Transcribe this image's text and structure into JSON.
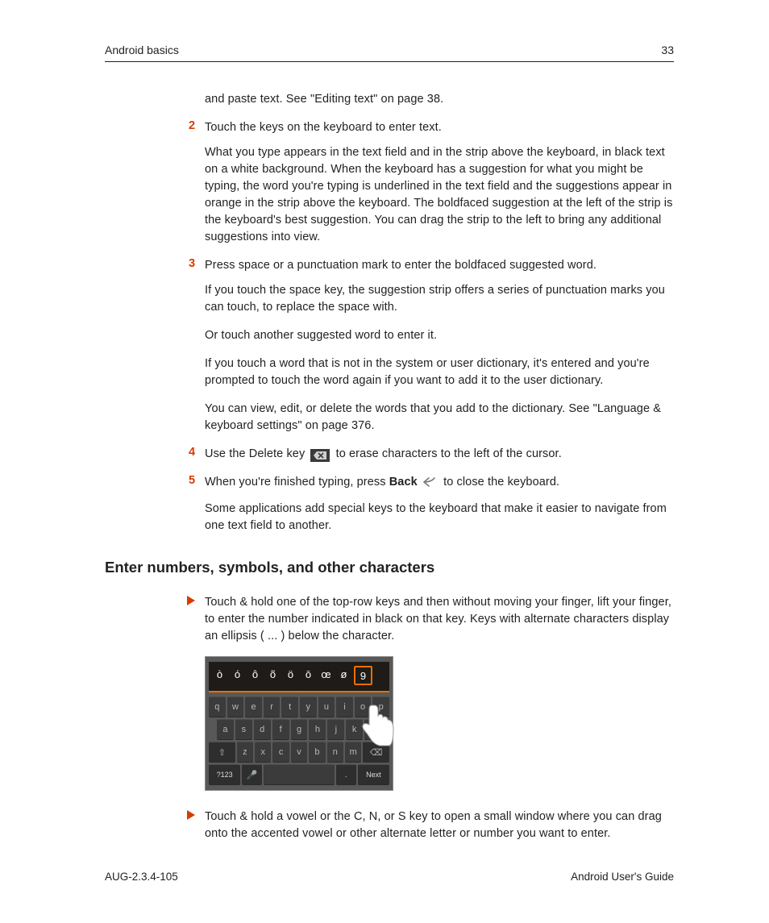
{
  "header": {
    "section": "Android basics",
    "page_number": "33"
  },
  "footer": {
    "doc_id": "AUG-2.3.4-105",
    "title": "Android User's Guide"
  },
  "intro_tail": "and paste text. See \"Editing text\" on page 38.",
  "steps": [
    {
      "num": "2",
      "lead": "Touch the keys on the keyboard to enter text.",
      "paras": [
        "What you type appears in the text field and in the strip above the keyboard, in black text on a white background. When the keyboard has a suggestion for what you might be typing, the word you're typing is underlined in the text field and the suggestions appear in orange in the strip above the keyboard. The boldfaced suggestion at the left of the strip is the keyboard's best suggestion. You can drag the strip to the left to bring any additional suggestions into view."
      ]
    },
    {
      "num": "3",
      "lead": "Press space or a punctuation mark to enter the boldfaced suggested word.",
      "paras": [
        "If you touch the space key, the suggestion strip offers a series of punctuation marks you can touch, to replace the space with.",
        "Or touch another suggested word to enter it.",
        "If you touch a word that is not in the system or user dictionary, it's entered and you're prompted to touch the word again if you want to add it to the user dictionary.",
        "You can view, edit, or delete the words that you add to the dictionary. See \"Language & keyboard settings\" on page 376."
      ]
    },
    {
      "num": "4",
      "lead_pre": "Use the Delete key ",
      "lead_post": " to erase characters to the left of the cursor."
    },
    {
      "num": "5",
      "lead_pre": "When you're finished typing, press ",
      "lead_bold": "Back",
      "lead_post": " to close the keyboard.",
      "paras": [
        "Some applications add special keys to the keyboard that make it easier to navigate from one text field to another."
      ]
    }
  ],
  "section_heading": "Enter numbers, symbols, and other characters",
  "bullets": [
    "Touch & hold one of the top-row keys and then without moving your finger, lift your finger, to enter the number indicated in black on that key. Keys with alternate characters display an ellipsis ( ... ) below the character.",
    "Touch & hold a vowel or the C, N, or S key to open a small window where you can drag onto the accented vowel or other alternate letter or number you want to enter."
  ],
  "keyboard": {
    "popup": [
      "ò",
      "ó",
      "ô",
      "õ",
      "ö",
      "ō",
      "œ",
      "ø",
      "9"
    ],
    "popup_selected_index": 8,
    "row1": [
      "q",
      "w",
      "e",
      "r",
      "t",
      "y",
      "u",
      "i",
      "o",
      "p"
    ],
    "row2": [
      "a",
      "s",
      "d",
      "f",
      "g",
      "h",
      "j",
      "k",
      "l"
    ],
    "row3_shift": "⇧",
    "row3": [
      "z",
      "x",
      "c",
      "v",
      "b",
      "n",
      "m"
    ],
    "row3_del": "⌫",
    "row4": {
      "sym": "?123",
      "mic": "🎤",
      "space": "",
      "dot": ".",
      "next": "Next"
    }
  }
}
